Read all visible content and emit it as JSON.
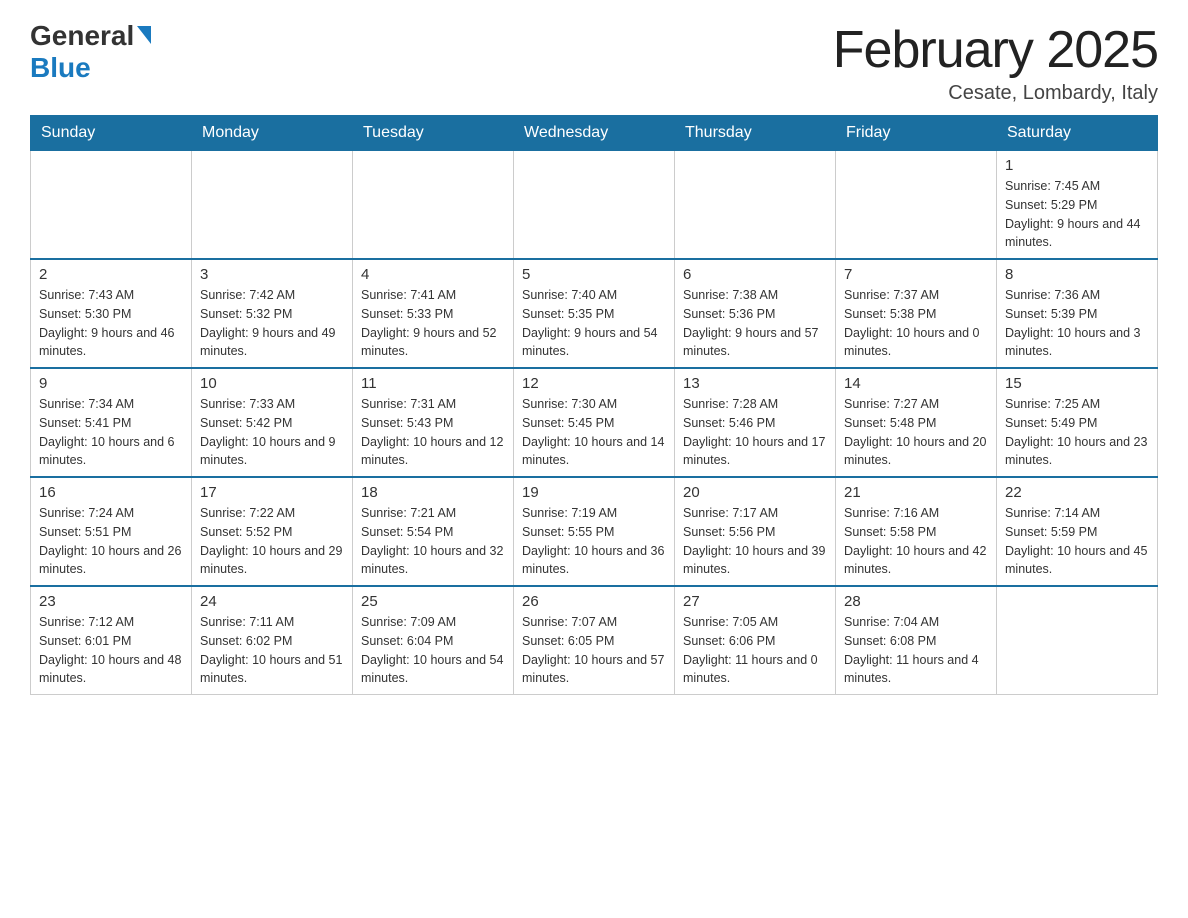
{
  "header": {
    "logo_general": "General",
    "logo_blue": "Blue",
    "month_title": "February 2025",
    "location": "Cesate, Lombardy, Italy"
  },
  "weekdays": [
    "Sunday",
    "Monday",
    "Tuesday",
    "Wednesday",
    "Thursday",
    "Friday",
    "Saturday"
  ],
  "weeks": [
    {
      "days": [
        {
          "num": "",
          "info": ""
        },
        {
          "num": "",
          "info": ""
        },
        {
          "num": "",
          "info": ""
        },
        {
          "num": "",
          "info": ""
        },
        {
          "num": "",
          "info": ""
        },
        {
          "num": "",
          "info": ""
        },
        {
          "num": "1",
          "info": "Sunrise: 7:45 AM\nSunset: 5:29 PM\nDaylight: 9 hours and 44 minutes."
        }
      ]
    },
    {
      "days": [
        {
          "num": "2",
          "info": "Sunrise: 7:43 AM\nSunset: 5:30 PM\nDaylight: 9 hours and 46 minutes."
        },
        {
          "num": "3",
          "info": "Sunrise: 7:42 AM\nSunset: 5:32 PM\nDaylight: 9 hours and 49 minutes."
        },
        {
          "num": "4",
          "info": "Sunrise: 7:41 AM\nSunset: 5:33 PM\nDaylight: 9 hours and 52 minutes."
        },
        {
          "num": "5",
          "info": "Sunrise: 7:40 AM\nSunset: 5:35 PM\nDaylight: 9 hours and 54 minutes."
        },
        {
          "num": "6",
          "info": "Sunrise: 7:38 AM\nSunset: 5:36 PM\nDaylight: 9 hours and 57 minutes."
        },
        {
          "num": "7",
          "info": "Sunrise: 7:37 AM\nSunset: 5:38 PM\nDaylight: 10 hours and 0 minutes."
        },
        {
          "num": "8",
          "info": "Sunrise: 7:36 AM\nSunset: 5:39 PM\nDaylight: 10 hours and 3 minutes."
        }
      ]
    },
    {
      "days": [
        {
          "num": "9",
          "info": "Sunrise: 7:34 AM\nSunset: 5:41 PM\nDaylight: 10 hours and 6 minutes."
        },
        {
          "num": "10",
          "info": "Sunrise: 7:33 AM\nSunset: 5:42 PM\nDaylight: 10 hours and 9 minutes."
        },
        {
          "num": "11",
          "info": "Sunrise: 7:31 AM\nSunset: 5:43 PM\nDaylight: 10 hours and 12 minutes."
        },
        {
          "num": "12",
          "info": "Sunrise: 7:30 AM\nSunset: 5:45 PM\nDaylight: 10 hours and 14 minutes."
        },
        {
          "num": "13",
          "info": "Sunrise: 7:28 AM\nSunset: 5:46 PM\nDaylight: 10 hours and 17 minutes."
        },
        {
          "num": "14",
          "info": "Sunrise: 7:27 AM\nSunset: 5:48 PM\nDaylight: 10 hours and 20 minutes."
        },
        {
          "num": "15",
          "info": "Sunrise: 7:25 AM\nSunset: 5:49 PM\nDaylight: 10 hours and 23 minutes."
        }
      ]
    },
    {
      "days": [
        {
          "num": "16",
          "info": "Sunrise: 7:24 AM\nSunset: 5:51 PM\nDaylight: 10 hours and 26 minutes."
        },
        {
          "num": "17",
          "info": "Sunrise: 7:22 AM\nSunset: 5:52 PM\nDaylight: 10 hours and 29 minutes."
        },
        {
          "num": "18",
          "info": "Sunrise: 7:21 AM\nSunset: 5:54 PM\nDaylight: 10 hours and 32 minutes."
        },
        {
          "num": "19",
          "info": "Sunrise: 7:19 AM\nSunset: 5:55 PM\nDaylight: 10 hours and 36 minutes."
        },
        {
          "num": "20",
          "info": "Sunrise: 7:17 AM\nSunset: 5:56 PM\nDaylight: 10 hours and 39 minutes."
        },
        {
          "num": "21",
          "info": "Sunrise: 7:16 AM\nSunset: 5:58 PM\nDaylight: 10 hours and 42 minutes."
        },
        {
          "num": "22",
          "info": "Sunrise: 7:14 AM\nSunset: 5:59 PM\nDaylight: 10 hours and 45 minutes."
        }
      ]
    },
    {
      "days": [
        {
          "num": "23",
          "info": "Sunrise: 7:12 AM\nSunset: 6:01 PM\nDaylight: 10 hours and 48 minutes."
        },
        {
          "num": "24",
          "info": "Sunrise: 7:11 AM\nSunset: 6:02 PM\nDaylight: 10 hours and 51 minutes."
        },
        {
          "num": "25",
          "info": "Sunrise: 7:09 AM\nSunset: 6:04 PM\nDaylight: 10 hours and 54 minutes."
        },
        {
          "num": "26",
          "info": "Sunrise: 7:07 AM\nSunset: 6:05 PM\nDaylight: 10 hours and 57 minutes."
        },
        {
          "num": "27",
          "info": "Sunrise: 7:05 AM\nSunset: 6:06 PM\nDaylight: 11 hours and 0 minutes."
        },
        {
          "num": "28",
          "info": "Sunrise: 7:04 AM\nSunset: 6:08 PM\nDaylight: 11 hours and 4 minutes."
        },
        {
          "num": "",
          "info": ""
        }
      ]
    }
  ]
}
